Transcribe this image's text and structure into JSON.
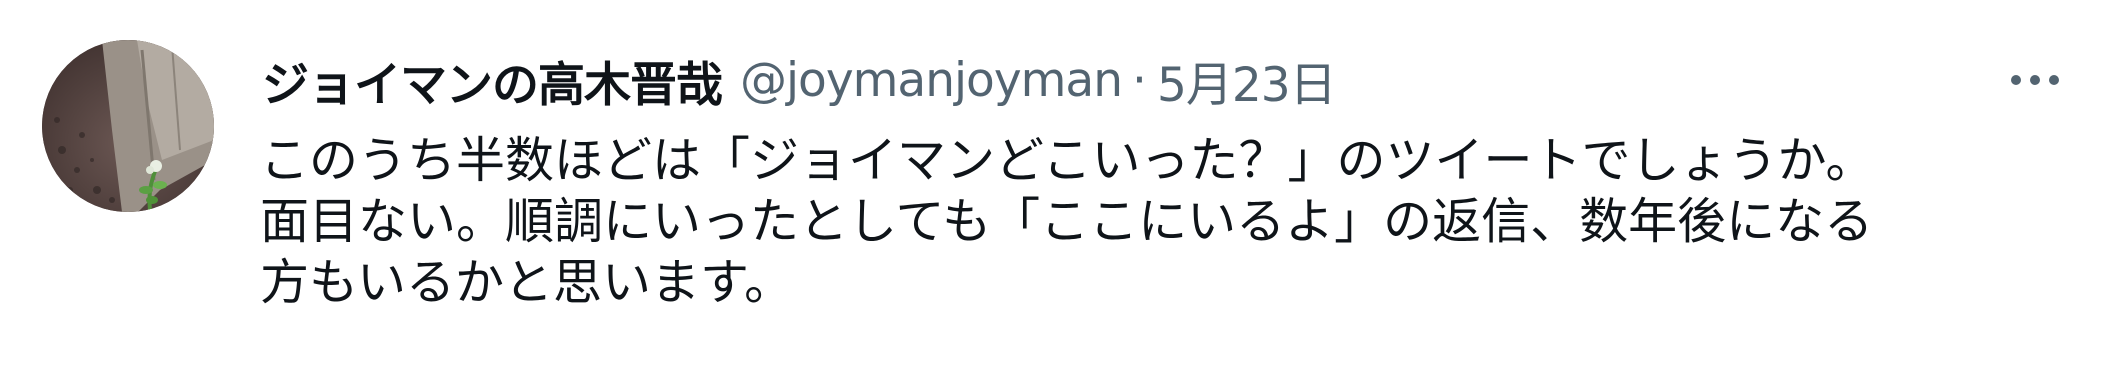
{
  "tweet": {
    "display_name": "ジョイマンの高木晋哉",
    "handle": "@joymanjoyman",
    "separator": "·",
    "date": "5月23日",
    "more_icon": "more-horizontal-icon",
    "avatar_icon": "profile-photo",
    "text_lines": [
      "このうち半数ほどは「ジョイマンどこいった？」のツイートでしょうか。",
      "面目ない。順調にいったとしても「ここにいるよ」の返信、数年後になる",
      "方もいるかと思います。"
    ]
  },
  "colors": {
    "text_primary": "#0f1419",
    "text_secondary": "#536471",
    "background": "#ffffff"
  }
}
